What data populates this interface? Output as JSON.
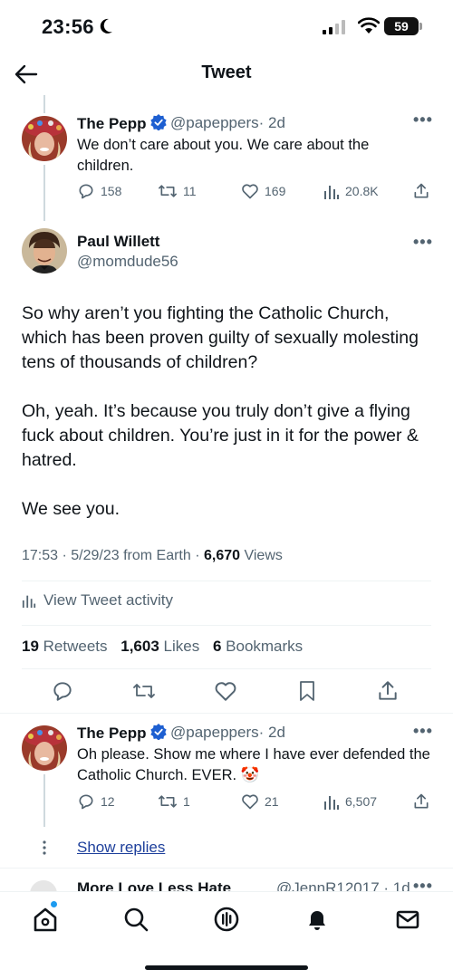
{
  "status_bar": {
    "time": "23:56",
    "battery": "59"
  },
  "nav": {
    "title": "Tweet"
  },
  "parent_tweet": {
    "name": "The Pepp",
    "handle": "@papeppers",
    "age": "· 2d",
    "text": "We don’t care about you.  We care about the children.",
    "replies": "158",
    "retweets": "11",
    "likes": "169",
    "views": "20.8K"
  },
  "main_tweet": {
    "name": "Paul Willett",
    "handle": "@momdude56",
    "paragraphs": [
      "So why aren’t you fighting the Catholic Church, which has been proven guilty of sexually molesting tens of thousands of children?",
      "Oh, yeah. It’s because you truly don’t give a flying fuck about children. You’re just in it for the power & hatred.",
      "We see you."
    ],
    "meta": {
      "time": "17:53 · 5/29/23 from Earth · ",
      "views_count": "6,670",
      "views_label": " Views"
    },
    "activity_label": "View Tweet activity",
    "stats": {
      "retweets_count": "19",
      "retweets_label": " Retweets",
      "likes_count": "1,603",
      "likes_label": " Likes",
      "bookmarks_count": "6",
      "bookmarks_label": " Bookmarks"
    }
  },
  "reply_tweet": {
    "name": "The Pepp",
    "handle": "@papeppers",
    "age": "· 2d",
    "text": "Oh please.  Show me where I have ever defended the Catholic Church.   EVER.",
    "emoji": "🤡",
    "replies": "12",
    "retweets": "1",
    "likes": "21",
    "views": "6,507",
    "show_replies": "Show replies"
  },
  "partial_tweet": {
    "name": "More Love Less Hate",
    "handle": "@JennR12017 · 1d"
  },
  "colors": {
    "accent": "#1d9bf0",
    "verified": "#1d5fd1",
    "muted": "#536471",
    "text": "#0f1419"
  }
}
